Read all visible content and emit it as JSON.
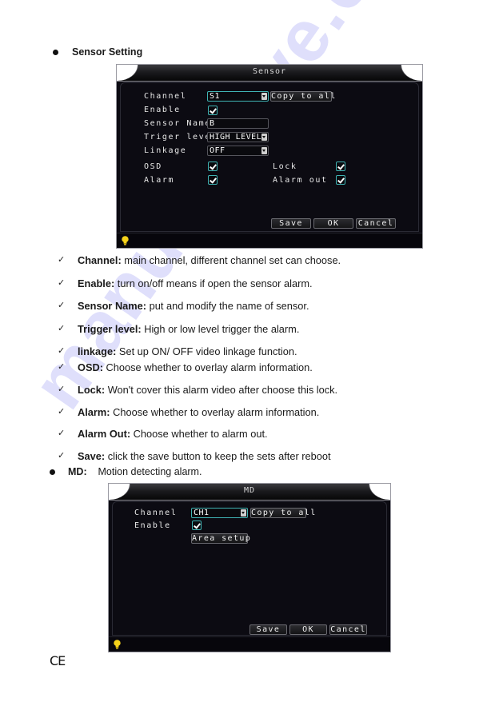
{
  "sections": {
    "sensor": {
      "heading": "Sensor Setting"
    },
    "md": {
      "heading_bold": "MD:",
      "heading_text": "Motion detecting alarm."
    }
  },
  "sensor_dialog": {
    "title": "Sensor",
    "fields": {
      "channel_label": "Channel",
      "channel_value": "S1",
      "copy_to_all": "Copy to all",
      "enable_label": "Enable",
      "enable_checked": true,
      "sensor_name_label": "Sensor Name",
      "sensor_name_value": "B",
      "trigger_level_label": "Triger level",
      "trigger_level_value": "HIGH LEVEL",
      "linkage_label": "Linkage",
      "linkage_value": "OFF",
      "osd_label": "OSD",
      "osd_checked": true,
      "lock_label": "Lock",
      "lock_checked": true,
      "alarm_label": "Alarm",
      "alarm_checked": true,
      "alarm_out_label": "Alarm out",
      "alarm_out_checked": true
    },
    "buttons": {
      "save": "Save",
      "ok": "OK",
      "cancel": "Cancel"
    },
    "status_icon": "lightbulb-icon"
  },
  "descriptions": [
    {
      "term": "Channel:",
      "text": " main channel, different channel set can choose."
    },
    {
      "term": "Enable:",
      "text": " turn on/off means if open the sensor alarm."
    },
    {
      "term": "Sensor Name:",
      "text": " put and modify the name of sensor."
    },
    {
      "term": "Trigger level:",
      "text": " High or low level trigger the alarm."
    },
    {
      "term": "linkage:",
      "text": " Set up ON/ OFF video linkage function."
    },
    {
      "term": "OSD:",
      "text": " Choose whether to overlay alarm information."
    },
    {
      "term": "Lock:",
      "text": " Won't cover this alarm video after choose this lock."
    },
    {
      "term": "Alarm:",
      "text": " Choose whether to overlay alarm information."
    },
    {
      "term": "Alarm Out:",
      "text": " Choose whether to alarm out."
    },
    {
      "term": "Save:",
      "text": " click the save button to keep the sets after reboot"
    }
  ],
  "md_dialog": {
    "title": "MD",
    "fields": {
      "channel_label": "Channel",
      "channel_value": "CH1",
      "copy_to_all": "Copy to all",
      "enable_label": "Enable",
      "enable_checked": true,
      "area_setup": "Area setup"
    },
    "buttons": {
      "save": "Save",
      "ok": "OK",
      "cancel": "Cancel"
    },
    "status_icon": "lightbulb-icon"
  },
  "footer": {
    "mark": "CE"
  },
  "watermark": "manualshive.com",
  "colors": {
    "dialog_bg": "#0c0b12",
    "focus_border": "#3fb3b3",
    "bulb": "#f5d21a",
    "watermark": "#6e6eeb"
  }
}
